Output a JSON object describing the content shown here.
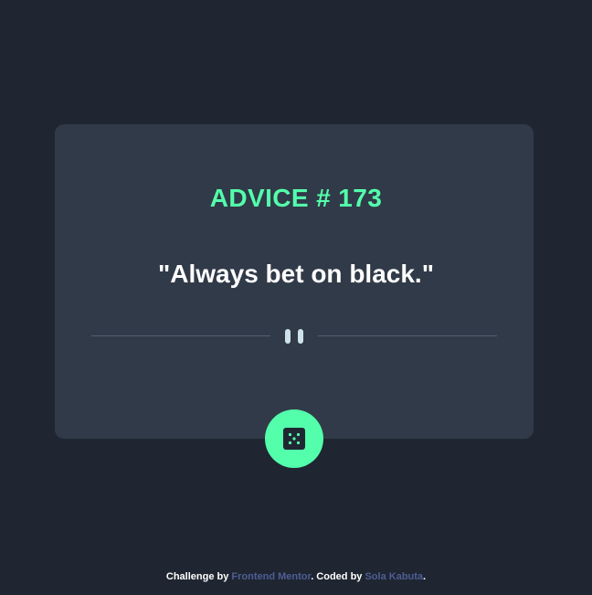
{
  "advice": {
    "label": "ADVICE # 173",
    "quote": "\"Always bet on black.\""
  },
  "divider": {
    "icon": "pause-icon"
  },
  "button": {
    "icon": "dice-icon"
  },
  "footer": {
    "prefix": "Challenge by ",
    "challenge_link": "Frontend Mentor",
    "middle": ". Coded by ",
    "author_link": "Sola Kabuta",
    "suffix": "."
  },
  "colors": {
    "background": "#1f2631",
    "card": "#313a48",
    "accent": "#53ffab",
    "link": "#4f5d96",
    "divider": "#4f5d74"
  }
}
